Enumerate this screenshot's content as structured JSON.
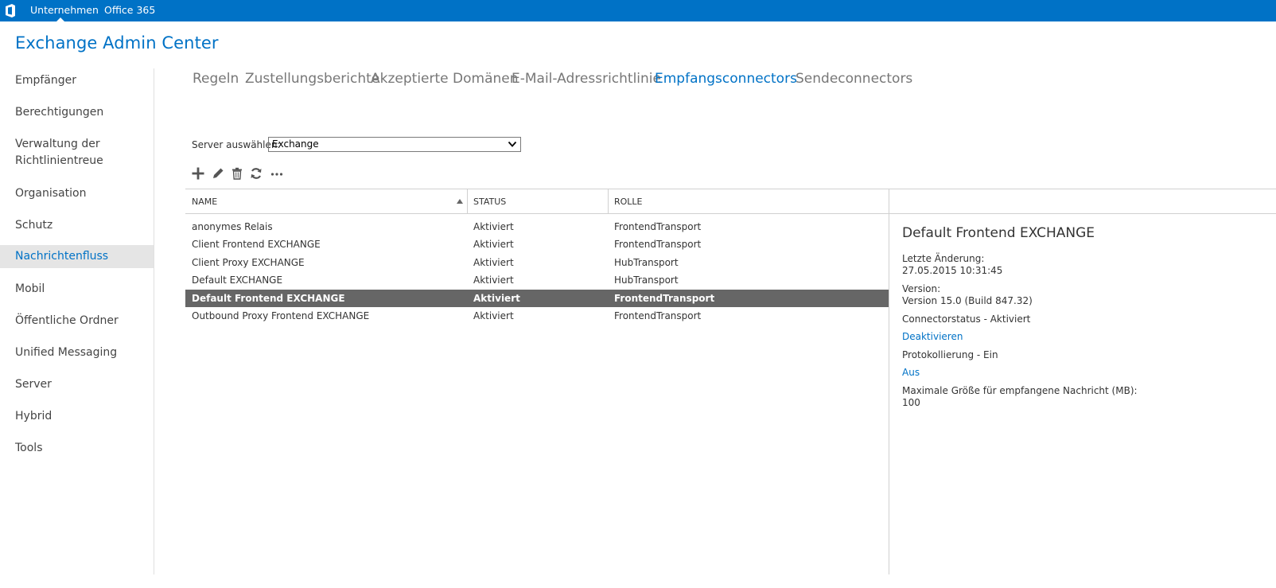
{
  "topbar": {
    "links": [
      "Unternehmen",
      "Office 365"
    ],
    "accent": "#0072c6"
  },
  "app": {
    "title": "Exchange Admin Center"
  },
  "sidebar": {
    "items": [
      {
        "label": "Empfänger"
      },
      {
        "label": "Berechtigungen"
      },
      {
        "label": "Verwaltung der Richtlinientreue"
      },
      {
        "label": "Organisation"
      },
      {
        "label": "Schutz"
      },
      {
        "label": "Nachrichtenfluss",
        "active": true
      },
      {
        "label": "Mobil"
      },
      {
        "label": "Öffentliche Ordner"
      },
      {
        "label": "Unified Messaging"
      },
      {
        "label": "Server"
      },
      {
        "label": "Hybrid"
      },
      {
        "label": "Tools"
      }
    ]
  },
  "tabs": [
    {
      "label": "Regeln"
    },
    {
      "label": "Zustellungsberichte"
    },
    {
      "label": "Akzeptierte Domänen"
    },
    {
      "label": "E-Mail-Adressrichtlinie"
    },
    {
      "label": "Empfangsconnectors",
      "active": true
    },
    {
      "label": "Sendeconnectors"
    }
  ],
  "server": {
    "label": "Server auswählen:",
    "value": "Exchange"
  },
  "toolbar": {
    "icons": [
      "add-icon",
      "edit-icon",
      "delete-icon",
      "refresh-icon",
      "more-icon"
    ]
  },
  "table": {
    "columns": [
      "NAME",
      "STATUS",
      "ROLLE"
    ],
    "sorted_column": "NAME",
    "sort_direction": "ascending",
    "rows": [
      {
        "name": "anonymes Relais",
        "status": "Aktiviert",
        "role": "FrontendTransport"
      },
      {
        "name": "Client Frontend EXCHANGE",
        "status": "Aktiviert",
        "role": "FrontendTransport"
      },
      {
        "name": "Client Proxy EXCHANGE",
        "status": "Aktiviert",
        "role": "HubTransport"
      },
      {
        "name": "Default EXCHANGE",
        "status": "Aktiviert",
        "role": "HubTransport"
      },
      {
        "name": "Default Frontend EXCHANGE",
        "status": "Aktiviert",
        "role": "FrontendTransport",
        "selected": true
      },
      {
        "name": "Outbound Proxy Frontend EXCHANGE",
        "status": "Aktiviert",
        "role": "FrontendTransport"
      }
    ]
  },
  "details": {
    "title": "Default Frontend EXCHANGE",
    "last_changed_label": "Letzte Änderung:",
    "last_changed_value": "27.05.2015 10:31:45",
    "version_label": "Version:",
    "version_value": "Version 15.0 (Build 847.32)",
    "connector_status": "Connectorstatus - Aktiviert",
    "deactivate_link": "Deaktivieren",
    "logging_status": "Protokollierung - Ein",
    "logging_off_link": "Aus",
    "max_size_label": "Maximale Größe für empfangene Nachricht (MB):",
    "max_size_value": "100"
  }
}
